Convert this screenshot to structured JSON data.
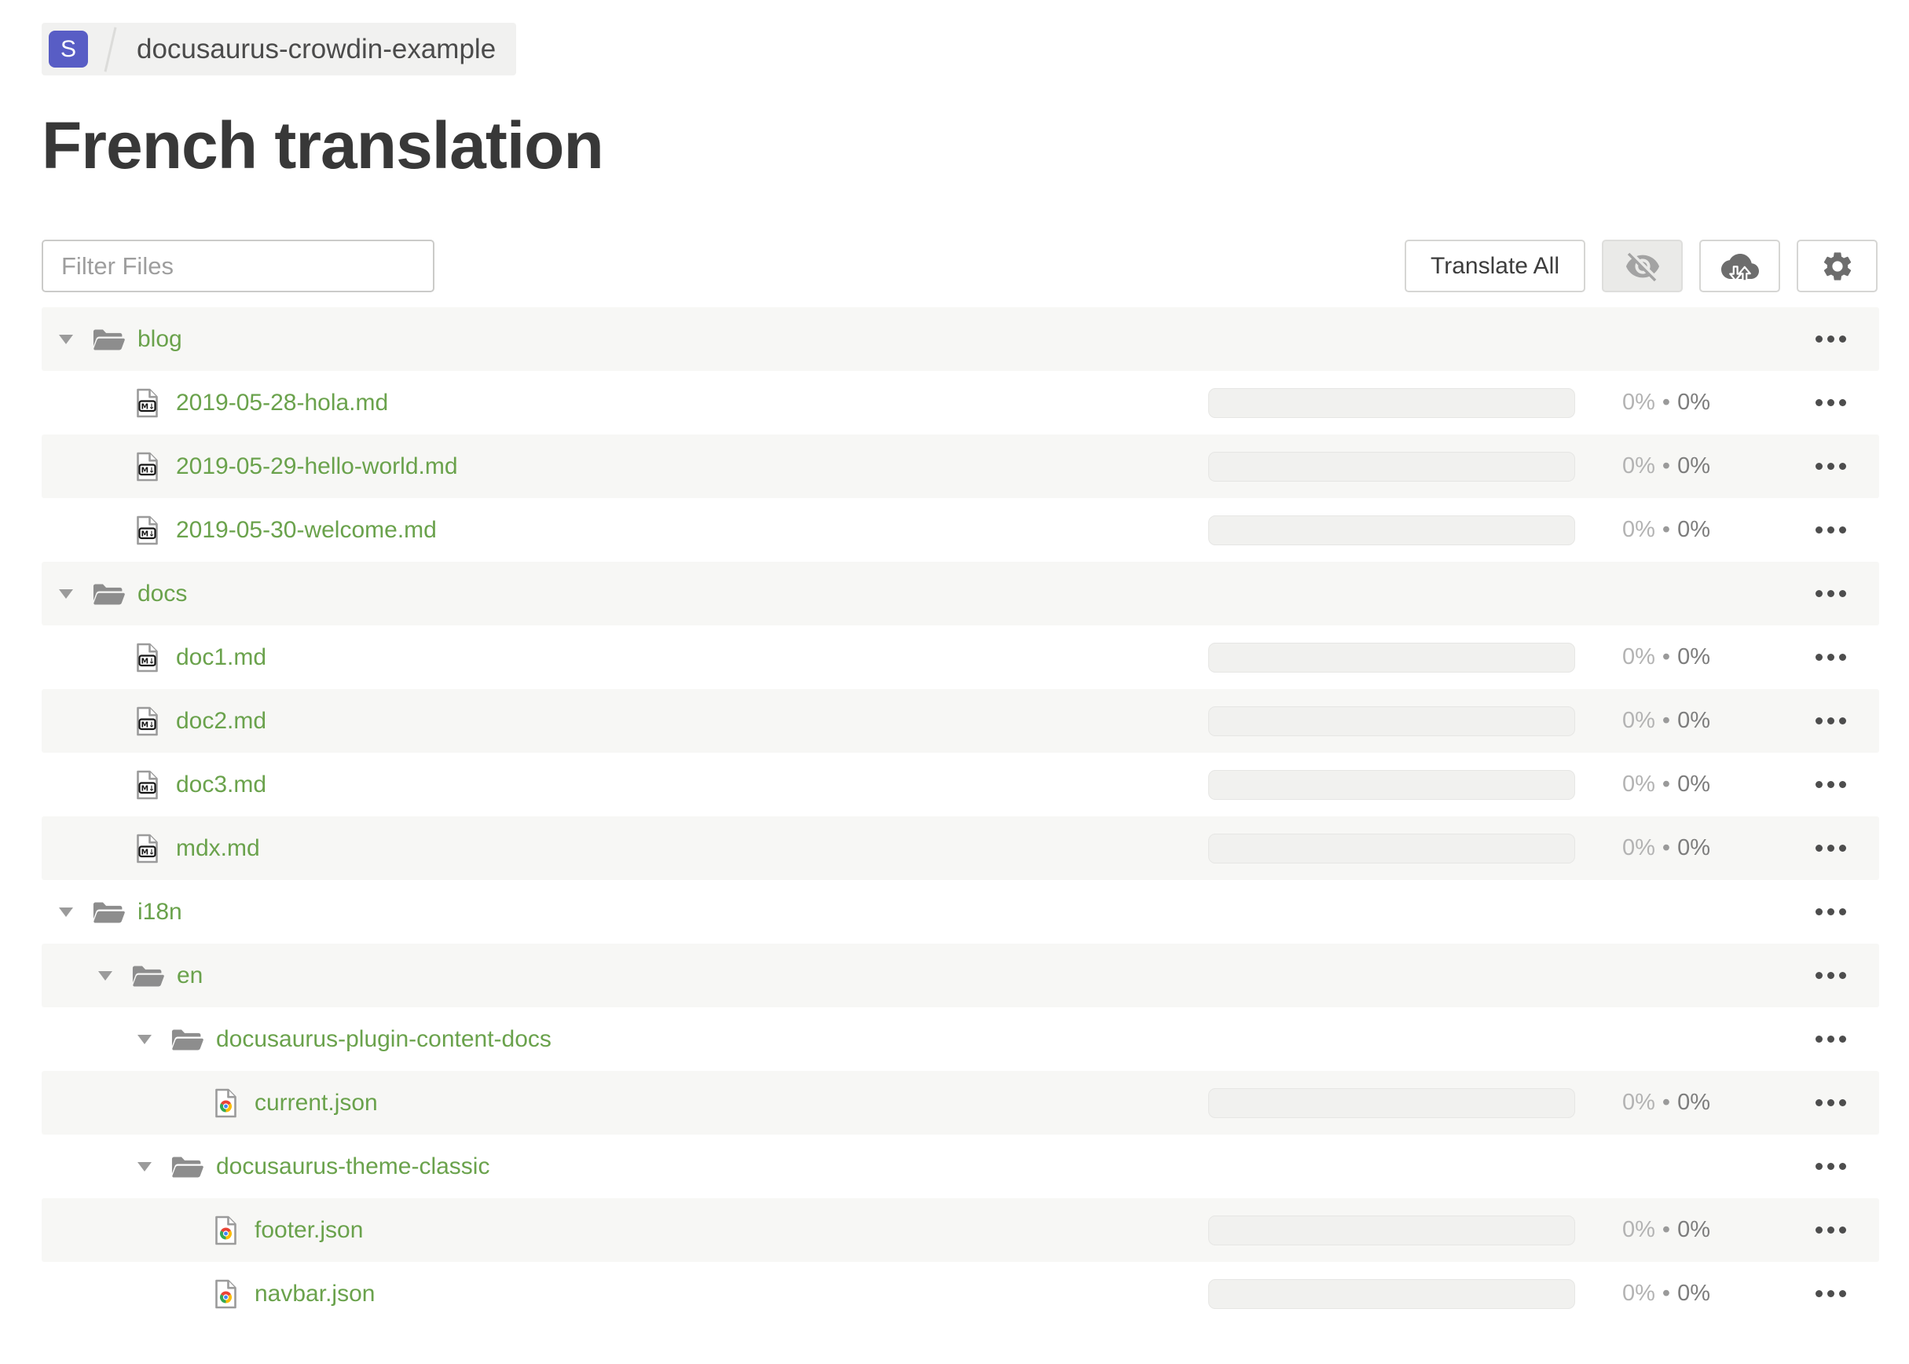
{
  "breadcrumb": {
    "project_initial": "S",
    "project_name": "docusaurus-crowdin-example"
  },
  "page": {
    "title": "French translation"
  },
  "toolbar": {
    "filter_placeholder": "Filter Files",
    "translate_all_label": "Translate All",
    "icon_buttons": [
      {
        "icon": "eye-off-icon",
        "active": true
      },
      {
        "icon": "cloud-sync-icon",
        "active": false
      },
      {
        "icon": "gear-icon",
        "active": false
      }
    ]
  },
  "tree": {
    "caret_icon": "caret-down-icon",
    "folder_icon": "folder-icon",
    "file_icons": {
      "markdown": "markdown-file-icon",
      "json": "chrome-json-file-icon"
    },
    "row_menu_icon": "ellipsis-icon",
    "progress_value": 0,
    "progress_separator": "•",
    "rows": [
      {
        "name": "blog",
        "type": "folder",
        "level": 0
      },
      {
        "name": "2019-05-28-hola.md",
        "type": "markdown",
        "level": 1,
        "translated": "0%",
        "approved": "0%"
      },
      {
        "name": "2019-05-29-hello-world.md",
        "type": "markdown",
        "level": 1,
        "translated": "0%",
        "approved": "0%"
      },
      {
        "name": "2019-05-30-welcome.md",
        "type": "markdown",
        "level": 1,
        "translated": "0%",
        "approved": "0%"
      },
      {
        "name": "docs",
        "type": "folder",
        "level": 0
      },
      {
        "name": "doc1.md",
        "type": "markdown",
        "level": 1,
        "translated": "0%",
        "approved": "0%"
      },
      {
        "name": "doc2.md",
        "type": "markdown",
        "level": 1,
        "translated": "0%",
        "approved": "0%"
      },
      {
        "name": "doc3.md",
        "type": "markdown",
        "level": 1,
        "translated": "0%",
        "approved": "0%"
      },
      {
        "name": "mdx.md",
        "type": "markdown",
        "level": 1,
        "translated": "0%",
        "approved": "0%"
      },
      {
        "name": "i18n",
        "type": "folder",
        "level": 0
      },
      {
        "name": "en",
        "type": "folder",
        "level": 1
      },
      {
        "name": "docusaurus-plugin-content-docs",
        "type": "folder",
        "level": 2
      },
      {
        "name": "current.json",
        "type": "json",
        "level": 3,
        "translated": "0%",
        "approved": "0%"
      },
      {
        "name": "docusaurus-theme-classic",
        "type": "folder",
        "level": 2
      },
      {
        "name": "footer.json",
        "type": "json",
        "level": 3,
        "translated": "0%",
        "approved": "0%"
      },
      {
        "name": "navbar.json",
        "type": "json",
        "level": 3,
        "translated": "0%",
        "approved": "0%"
      }
    ]
  },
  "colors": {
    "accent_green": "#6aa24c",
    "badge_indigo": "#585dc5",
    "stripe_bg": "#f7f7f5",
    "icon_gray": "#8d8d8d"
  }
}
